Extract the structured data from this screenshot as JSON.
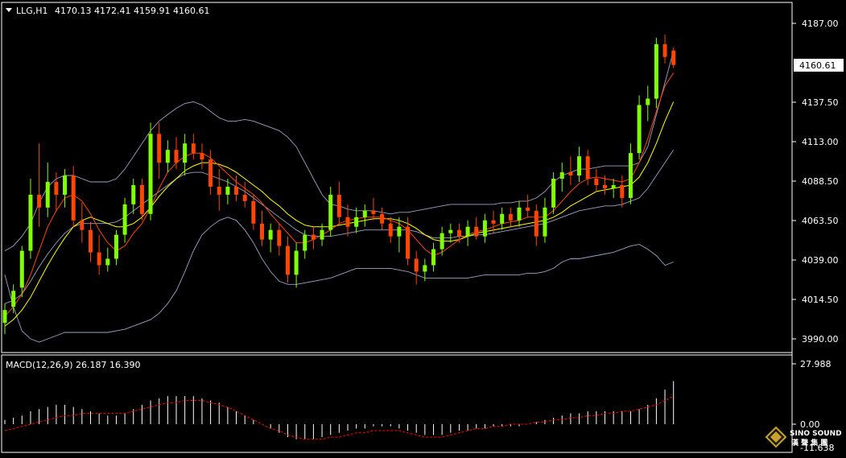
{
  "header": {
    "symbol_label": "LLG,H1",
    "ohlc": "4170.13 4172.41 4159.91 4160.61"
  },
  "current_price_label": "4160.61",
  "price_axis": {
    "ticks": [
      "4187.00",
      "4137.50",
      "4113.00",
      "4088.50",
      "4063.50",
      "4039.00",
      "4014.50",
      "3990.00"
    ]
  },
  "macd_panel": {
    "label": "MACD(12,26,9) 26.187 16.390",
    "ticks": [
      "27.988",
      "0.00",
      "-11.638"
    ]
  },
  "logo": {
    "line1": "SINO SOUND",
    "line2": "漢 聲 集 團"
  },
  "colors": {
    "background": "#000000",
    "frame": "#ffffff",
    "bull": "#7fff00",
    "bear": "#ff4500",
    "ma_fast": "#ff4500",
    "ma_slow": "#ffff00",
    "bands": "#9aa3c7",
    "macd_hist": "#ffffff",
    "macd_signal": "#ff0000"
  },
  "chart_data": {
    "type": "candlestick",
    "symbol": "LLG",
    "timeframe": "H1",
    "ylim": [
      3982,
      4196
    ],
    "candles": [
      [
        4000,
        4012,
        3993,
        4008
      ],
      [
        4010,
        4024,
        4006,
        4020
      ],
      [
        4022,
        4048,
        4016,
        4045
      ],
      [
        4045,
        4090,
        4040,
        4080
      ],
      [
        4080,
        4112,
        4060,
        4072
      ],
      [
        4072,
        4100,
        4066,
        4088
      ],
      [
        4088,
        4094,
        4070,
        4080
      ],
      [
        4080,
        4096,
        4072,
        4092
      ],
      [
        4092,
        4098,
        4060,
        4064
      ],
      [
        4064,
        4075,
        4050,
        4058
      ],
      [
        4058,
        4063,
        4038,
        4044
      ],
      [
        4044,
        4055,
        4030,
        4036
      ],
      [
        4036,
        4047,
        4032,
        4040
      ],
      [
        4040,
        4058,
        4036,
        4055
      ],
      [
        4055,
        4078,
        4050,
        4074
      ],
      [
        4074,
        4090,
        4068,
        4086
      ],
      [
        4086,
        4090,
        4064,
        4068
      ],
      [
        4068,
        4125,
        4064,
        4118
      ],
      [
        4118,
        4125,
        4090,
        4100
      ],
      [
        4100,
        4114,
        4094,
        4108
      ],
      [
        4108,
        4116,
        4096,
        4100
      ],
      [
        4100,
        4118,
        4092,
        4112
      ],
      [
        4112,
        4118,
        4102,
        4106
      ],
      [
        4106,
        4112,
        4096,
        4102
      ],
      [
        4102,
        4108,
        4080,
        4085
      ],
      [
        4085,
        4096,
        4070,
        4080
      ],
      [
        4080,
        4090,
        4074,
        4085
      ],
      [
        4085,
        4092,
        4076,
        4080
      ],
      [
        4080,
        4088,
        4072,
        4076
      ],
      [
        4076,
        4080,
        4058,
        4062
      ],
      [
        4062,
        4070,
        4048,
        4052
      ],
      [
        4052,
        4062,
        4044,
        4058
      ],
      [
        4058,
        4062,
        4042,
        4048
      ],
      [
        4048,
        4054,
        4025,
        4030
      ],
      [
        4030,
        4050,
        4022,
        4045
      ],
      [
        4045,
        4058,
        4040,
        4055
      ],
      [
        4055,
        4060,
        4046,
        4052
      ],
      [
        4052,
        4062,
        4048,
        4058
      ],
      [
        4058,
        4085,
        4054,
        4080
      ],
      [
        4080,
        4088,
        4062,
        4066
      ],
      [
        4066,
        4074,
        4054,
        4060
      ],
      [
        4060,
        4072,
        4056,
        4066
      ],
      [
        4066,
        4074,
        4060,
        4070
      ],
      [
        4070,
        4078,
        4064,
        4068
      ],
      [
        4068,
        4072,
        4058,
        4062
      ],
      [
        4062,
        4066,
        4050,
        4054
      ],
      [
        4054,
        4066,
        4044,
        4060
      ],
      [
        4060,
        4066,
        4036,
        4040
      ],
      [
        4040,
        4045,
        4024,
        4032
      ],
      [
        4032,
        4040,
        4026,
        4036
      ],
      [
        4036,
        4050,
        4032,
        4046
      ],
      [
        4046,
        4060,
        4042,
        4056
      ],
      [
        4056,
        4062,
        4050,
        4058
      ],
      [
        4058,
        4062,
        4050,
        4054
      ],
      [
        4054,
        4064,
        4048,
        4060
      ],
      [
        4060,
        4066,
        4052,
        4054
      ],
      [
        4054,
        4068,
        4050,
        4064
      ],
      [
        4064,
        4070,
        4056,
        4062
      ],
      [
        4062,
        4072,
        4058,
        4068
      ],
      [
        4068,
        4072,
        4060,
        4064
      ],
      [
        4064,
        4076,
        4060,
        4072
      ],
      [
        4072,
        4080,
        4066,
        4070
      ],
      [
        4070,
        4074,
        4048,
        4054
      ],
      [
        4054,
        4078,
        4050,
        4072
      ],
      [
        4072,
        4094,
        4068,
        4090
      ],
      [
        4090,
        4100,
        4082,
        4094
      ],
      [
        4094,
        4104,
        4086,
        4092
      ],
      [
        4092,
        4110,
        4088,
        4104
      ],
      [
        4104,
        4108,
        4086,
        4090
      ],
      [
        4090,
        4096,
        4082,
        4086
      ],
      [
        4086,
        4092,
        4080,
        4084
      ],
      [
        4084,
        4090,
        4078,
        4086
      ],
      [
        4086,
        4092,
        4072,
        4078
      ],
      [
        4078,
        4112,
        4074,
        4106
      ],
      [
        4106,
        4142,
        4102,
        4136
      ],
      [
        4136,
        4148,
        4126,
        4140
      ],
      [
        4140,
        4178,
        4134,
        4174
      ],
      [
        4174,
        4180,
        4162,
        4166
      ],
      [
        4170,
        4172,
        4159,
        4161
      ]
    ],
    "ma_fast": [
      4004,
      4010,
      4018,
      4030,
      4045,
      4060,
      4070,
      4078,
      4080,
      4076,
      4068,
      4058,
      4050,
      4045,
      4048,
      4056,
      4062,
      4072,
      4084,
      4094,
      4100,
      4104,
      4106,
      4106,
      4103,
      4098,
      4093,
      4088,
      4084,
      4080,
      4075,
      4068,
      4062,
      4056,
      4050,
      4050,
      4052,
      4055,
      4058,
      4062,
      4064,
      4065,
      4066,
      4066,
      4066,
      4064,
      4062,
      4058,
      4052,
      4046,
      4042,
      4044,
      4048,
      4052,
      4055,
      4057,
      4058,
      4060,
      4062,
      4063,
      4064,
      4066,
      4066,
      4066,
      4070,
      4076,
      4082,
      4087,
      4090,
      4091,
      4090,
      4089,
      4088,
      4090,
      4100,
      4115,
      4132,
      4148,
      4156
    ],
    "ma_slow": [
      3998,
      4002,
      4008,
      4016,
      4026,
      4036,
      4045,
      4053,
      4060,
      4064,
      4066,
      4064,
      4062,
      4060,
      4060,
      4062,
      4066,
      4072,
      4079,
      4085,
      4090,
      4095,
      4098,
      4100,
      4100,
      4099,
      4097,
      4094,
      4090,
      4086,
      4082,
      4077,
      4073,
      4068,
      4064,
      4061,
      4060,
      4060,
      4060,
      4061,
      4062,
      4063,
      4064,
      4065,
      4065,
      4065,
      4064,
      4062,
      4059,
      4055,
      4052,
      4051,
      4051,
      4052,
      4054,
      4056,
      4057,
      4058,
      4059,
      4060,
      4061,
      4062,
      4063,
      4064,
      4066,
      4069,
      4073,
      4076,
      4079,
      4082,
      4083,
      4084,
      4085,
      4086,
      4091,
      4100,
      4112,
      4126,
      4138
    ],
    "bb_upper": [
      4045,
      4048,
      4054,
      4062,
      4075,
      4085,
      4090,
      4092,
      4092,
      4090,
      4088,
      4088,
      4088,
      4090,
      4096,
      4104,
      4112,
      4120,
      4126,
      4130,
      4134,
      4137,
      4138,
      4136,
      4132,
      4128,
      4126,
      4126,
      4127,
      4126,
      4124,
      4122,
      4120,
      4116,
      4110,
      4100,
      4090,
      4080,
      4074,
      4073,
      4071,
      4070,
      4070,
      4070,
      4069,
      4068,
      4069,
      4069,
      4070,
      4071,
      4072,
      4073,
      4074,
      4074,
      4074,
      4074,
      4074,
      4074,
      4075,
      4075,
      4076,
      4076,
      4078,
      4082,
      4088,
      4092,
      4094,
      4096,
      4096,
      4097,
      4098,
      4098,
      4098,
      4098,
      4100,
      4110,
      4130,
      4150,
      4170
    ],
    "bb_middle": [
      4012,
      4014,
      4018,
      4026,
      4035,
      4043,
      4050,
      4056,
      4060,
      4062,
      4062,
      4062,
      4062,
      4063,
      4066,
      4070,
      4074,
      4078,
      4082,
      4086,
      4090,
      4093,
      4094,
      4094,
      4092,
      4090,
      4088,
      4085,
      4082,
      4078,
      4074,
      4070,
      4066,
      4062,
      4058,
      4055,
      4054,
      4054,
      4054,
      4055,
      4056,
      4057,
      4058,
      4058,
      4058,
      4058,
      4058,
      4058,
      4057,
      4055,
      4053,
      4053,
      4053,
      4054,
      4054,
      4055,
      4055,
      4056,
      4057,
      4058,
      4059,
      4060,
      4061,
      4062,
      4064,
      4066,
      4068,
      4070,
      4071,
      4072,
      4073,
      4073,
      4074,
      4076,
      4078,
      4084,
      4092,
      4100,
      4108
    ],
    "bb_lower": [
      4030,
      4010,
      3995,
      3990,
      3988,
      3990,
      3992,
      3994,
      3994,
      3994,
      3994,
      3994,
      3994,
      3995,
      3996,
      3998,
      4000,
      4002,
      4006,
      4012,
      4020,
      4032,
      4045,
      4055,
      4060,
      4064,
      4066,
      4064,
      4058,
      4050,
      4040,
      4032,
      4026,
      4024,
      4024,
      4025,
      4026,
      4027,
      4028,
      4030,
      4032,
      4034,
      4034,
      4034,
      4034,
      4034,
      4033,
      4032,
      4030,
      4028,
      4028,
      4028,
      4028,
      4028,
      4028,
      4029,
      4030,
      4030,
      4030,
      4030,
      4030,
      4031,
      4031,
      4032,
      4034,
      4038,
      4040,
      4040,
      4041,
      4042,
      4043,
      4044,
      4046,
      4048,
      4049,
      4046,
      4042,
      4036,
      4038
    ],
    "macd": {
      "histogram": [
        2,
        3,
        4,
        6,
        7,
        8,
        9,
        9,
        8,
        7,
        6,
        5,
        4,
        4,
        5,
        7,
        9,
        11,
        12,
        13,
        13,
        13,
        13,
        12,
        11,
        10,
        8,
        6,
        4,
        2,
        0,
        -2,
        -4,
        -6,
        -7,
        -7,
        -7,
        -6,
        -5,
        -4,
        -3,
        -2,
        -2,
        -1,
        -1,
        -1,
        -2,
        -3,
        -4,
        -5,
        -5,
        -5,
        -4,
        -3,
        -3,
        -2,
        -2,
        -1,
        -1,
        -1,
        -1,
        0,
        1,
        2,
        3,
        4,
        5,
        5,
        6,
        6,
        6,
        6,
        6,
        6,
        7,
        9,
        12,
        16,
        20
      ],
      "signal": [
        -3,
        -2,
        -1,
        0,
        1,
        2,
        3,
        4,
        4,
        5,
        5,
        5,
        5,
        5,
        5,
        6,
        7,
        8,
        9,
        10,
        10,
        11,
        11,
        11,
        10,
        9,
        8,
        6,
        4,
        2,
        0,
        -2,
        -3,
        -5,
        -6,
        -7,
        -7,
        -7,
        -6,
        -6,
        -5,
        -4,
        -4,
        -3,
        -3,
        -3,
        -3,
        -4,
        -5,
        -6,
        -6,
        -6,
        -5,
        -4,
        -3,
        -2,
        -2,
        -1,
        -1,
        0,
        0,
        0,
        1,
        1,
        2,
        2,
        3,
        3,
        4,
        4,
        5,
        5,
        6,
        6,
        7,
        8,
        9,
        11,
        13
      ],
      "ylim": [
        -11.638,
        27.988
      ]
    }
  }
}
